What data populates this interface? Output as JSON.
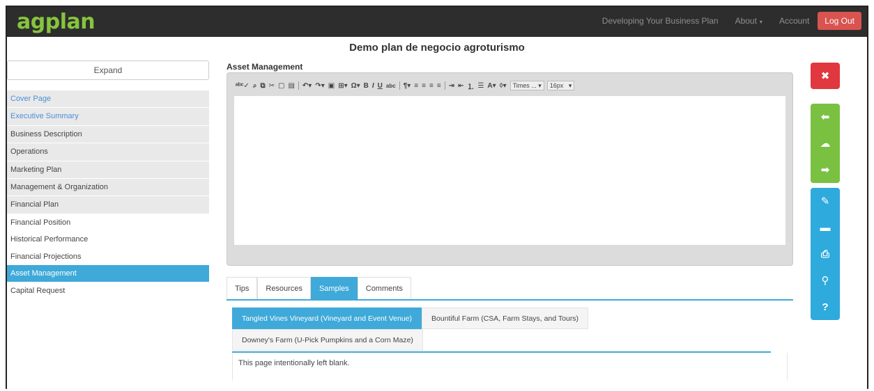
{
  "navbar": {
    "logo": "agplan",
    "links": [
      "Developing Your Business Plan",
      "About",
      "Account"
    ],
    "about_caret": "▾",
    "logout_label": "Log Out"
  },
  "page": {
    "title": "Demo plan de negocio agroturismo"
  },
  "sidebar": {
    "expand_label": "Expand",
    "items": [
      "Cover Page",
      "Executive Summary",
      "Business Description",
      "Operations",
      "Marketing Plan",
      "Management & Organization",
      "Financial Plan",
      "Financial Position",
      "Historical Performance",
      "Financial Projections",
      "Asset Management",
      "Capital Request"
    ],
    "active_item": "Asset Management"
  },
  "editor": {
    "label": "Asset Management",
    "font_select": "Times ...",
    "size_select": "16px"
  },
  "right_bar": {
    "icons": [
      "close-icon",
      "arrow-left-icon",
      "cloud-upload-icon",
      "arrow-right-icon",
      "pencil-icon",
      "comment-icon",
      "print-icon",
      "paperclip-icon",
      "help-icon"
    ]
  },
  "tabs": [
    "Tips",
    "Resources",
    "Samples",
    "Comments"
  ],
  "active_tab": "Samples",
  "samples": {
    "items": [
      "Tangled Vines Vineyard (Vineyard and Event Venue)",
      "Bountiful Farm (CSA, Farm Stays, and Tours)",
      "Downey's Farm (U-Pick Pumpkins and a Corn Maze)"
    ],
    "active": "Tangled Vines Vineyard (Vineyard and Event Venue)",
    "body_text": "This page intentionally left blank."
  },
  "colors": {
    "navbar_bg": "#2d2d2d",
    "logo_green": "#86c43d",
    "accent_blue": "#3fa9d9",
    "danger_red": "#e0383e",
    "success_green": "#7ac142"
  }
}
